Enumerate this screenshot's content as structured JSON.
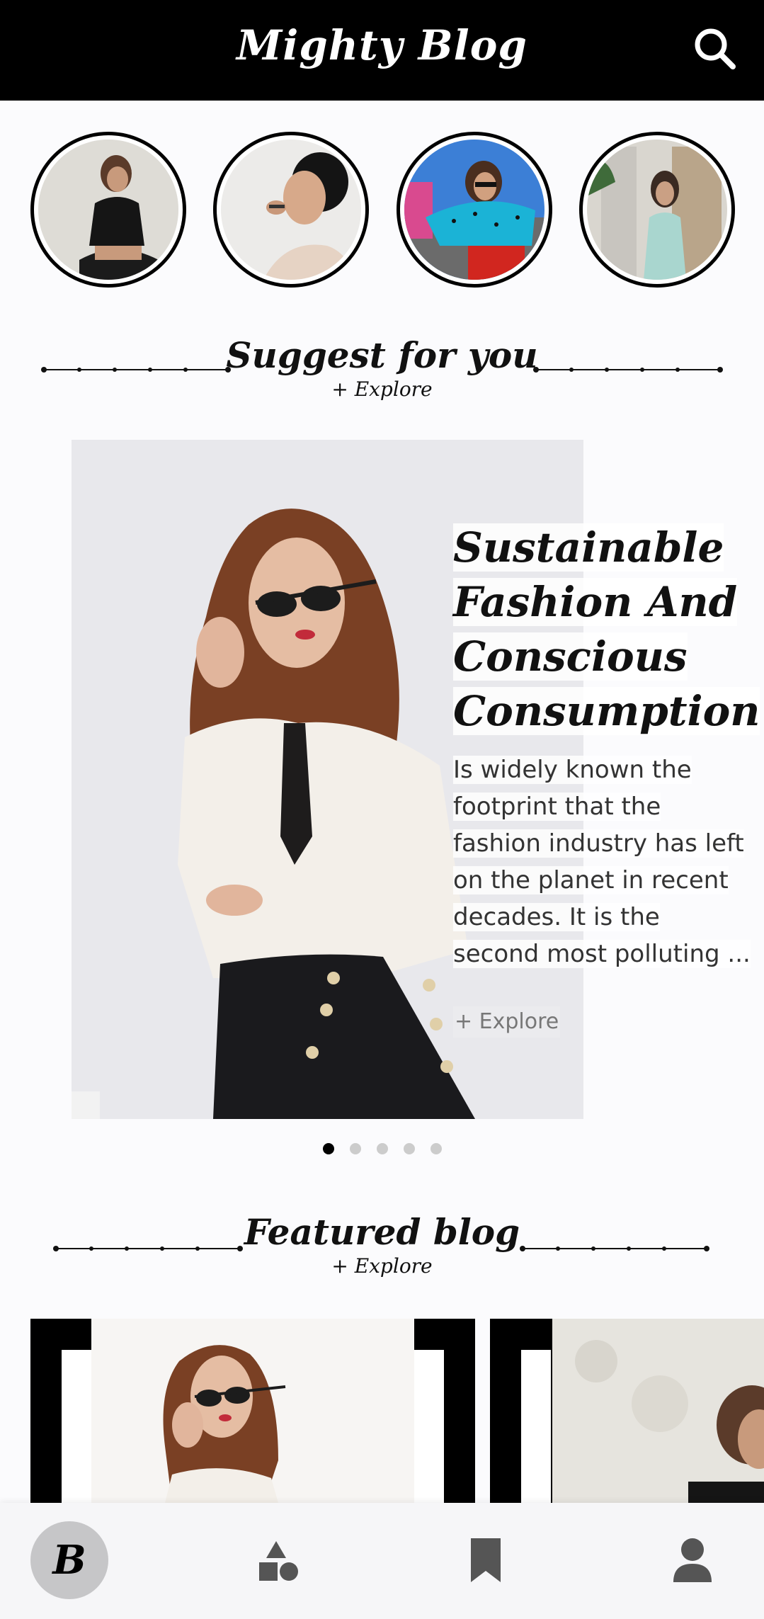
{
  "app": {
    "title": "Mighty Blog"
  },
  "icons": {
    "search": "search-icon",
    "home": "home-icon",
    "categories": "categories-icon",
    "bookmark": "bookmark-icon",
    "profile": "profile-icon"
  },
  "stories": [
    {
      "name": "story-1"
    },
    {
      "name": "story-2"
    },
    {
      "name": "story-3"
    },
    {
      "name": "story-4"
    }
  ],
  "suggest": {
    "title": "Suggest for you",
    "explore": "+ Explore",
    "card": {
      "title_lines": [
        "Sustainable",
        "Fashion And",
        "Conscious",
        "Consumption"
      ],
      "body_lines": [
        "Is widely known the",
        "footprint that the",
        "fashion industry has left",
        "on the planet in recent",
        "decades. It is the",
        "second most polluting ..."
      ],
      "explore": "+ Explore"
    },
    "pagination": {
      "count": 5,
      "active": 0
    }
  },
  "featured": {
    "title": "Featured blog",
    "explore": "+ Explore"
  },
  "bottom_nav": {
    "home_glyph": "B",
    "active": "home"
  },
  "colors": {
    "appbar": "#000000",
    "background": "#fbfbfd",
    "active_nav": "#c6c6c8",
    "dot_active": "#000000",
    "dot_inactive": "#cccccc"
  }
}
